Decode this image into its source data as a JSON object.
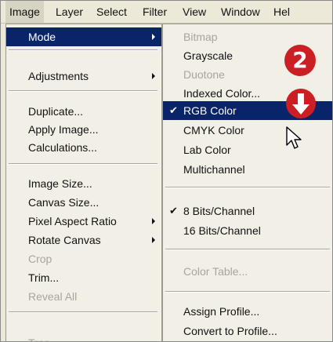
{
  "menubar": {
    "items": [
      "Image",
      "Layer",
      "Select",
      "Filter",
      "View",
      "Window",
      "Hel"
    ]
  },
  "image_menu": {
    "items": [
      {
        "label": "Mode",
        "state": "selected",
        "submenu": true
      },
      {
        "label": "Adjustments",
        "submenu": true
      },
      {
        "label": "Duplicate..."
      },
      {
        "label": "Apply Image..."
      },
      {
        "label": "Calculations..."
      },
      {
        "label": "Image Size..."
      },
      {
        "label": "Canvas Size..."
      },
      {
        "label": "Pixel Aspect Ratio",
        "submenu": true
      },
      {
        "label": "Rotate Canvas",
        "submenu": true
      },
      {
        "label": "Crop",
        "state": "disabled"
      },
      {
        "label": "Trim..."
      },
      {
        "label": "Reveal All",
        "state": "disabled"
      },
      {
        "label": "Trap...",
        "state": "disabled"
      }
    ]
  },
  "mode_submenu": {
    "items": [
      {
        "label": "Bitmap",
        "state": "disabled"
      },
      {
        "label": "Grayscale"
      },
      {
        "label": "Duotone",
        "state": "disabled"
      },
      {
        "label": "Indexed Color..."
      },
      {
        "label": "RGB Color",
        "state": "selected",
        "checked": true
      },
      {
        "label": "CMYK Color"
      },
      {
        "label": "Lab Color"
      },
      {
        "label": "Multichannel"
      },
      {
        "label": "8 Bits/Channel",
        "checked": true
      },
      {
        "label": "16 Bits/Channel"
      },
      {
        "label": "Color Table...",
        "state": "disabled"
      },
      {
        "label": "Assign Profile..."
      },
      {
        "label": "Convert to Profile..."
      }
    ]
  },
  "overlay": {
    "step_badge": "2",
    "icons": [
      "down-arrow-icon",
      "mouse-pointer-icon"
    ]
  },
  "colors": {
    "highlight": "#0a246a",
    "menu_bg": "#f1efe6",
    "annotation_red": "#cc1f24"
  }
}
